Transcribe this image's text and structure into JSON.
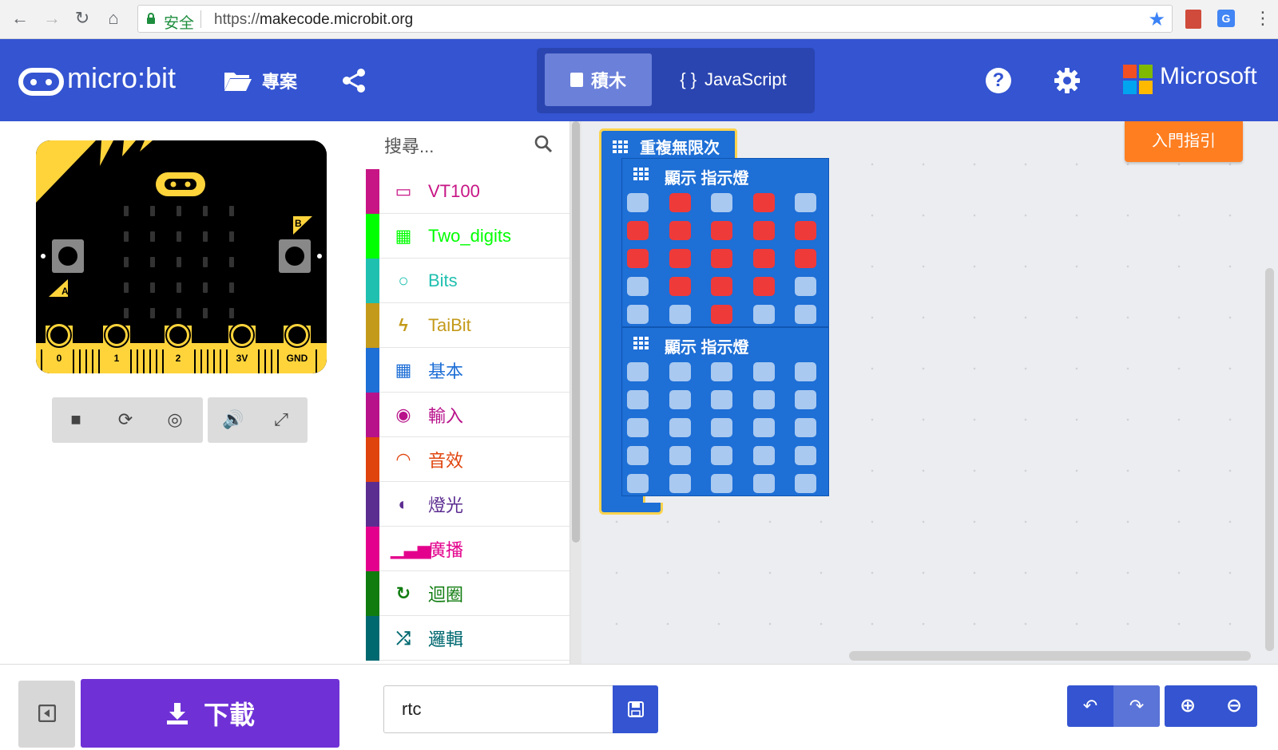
{
  "browser": {
    "secure_label": "安全",
    "url_scheme": "https://",
    "url_host": "makecode.microbit.org"
  },
  "header": {
    "logo_text": "micro:bit",
    "projects_label": "專案",
    "tab_blocks": "積木",
    "tab_js_brace": "{ }",
    "tab_js": "JavaScript",
    "brand": "Microsoft",
    "help_glyph": "?"
  },
  "simulator": {
    "pins": [
      "0",
      "1",
      "2",
      "3V",
      "GND"
    ],
    "button_a": "A",
    "button_b": "B"
  },
  "toolbox": {
    "search_placeholder": "搜尋...",
    "categories": [
      {
        "label": "VT100",
        "color": "#c71585",
        "icon": "monitor-icon"
      },
      {
        "label": "Two_digits",
        "color": "#00ff00",
        "icon": "grid-icon"
      },
      {
        "label": "Bits",
        "color": "#20c0b0",
        "icon": "circle-icon"
      },
      {
        "label": "TaiBit",
        "color": "#c49a1a",
        "icon": "bolt-icon"
      },
      {
        "label": "基本",
        "color": "#1e6fd6",
        "icon": "grid-dots-icon"
      },
      {
        "label": "輸入",
        "color": "#b8128b",
        "icon": "target-icon"
      },
      {
        "label": "音效",
        "color": "#e0440e",
        "icon": "headphones-icon"
      },
      {
        "label": "燈光",
        "color": "#5c2d91",
        "icon": "toggle-icon"
      },
      {
        "label": "廣播",
        "color": "#e3008c",
        "icon": "signal-icon"
      },
      {
        "label": "迴圈",
        "color": "#107c10",
        "icon": "loop-icon"
      },
      {
        "label": "邏輯",
        "color": "#006970",
        "icon": "shuffle-icon"
      }
    ]
  },
  "workspace": {
    "forever_label": "重複無限次",
    "show_leds_label": "顯示  指示燈",
    "intro_button": "入門指引",
    "led_on_color": "#ef3a3a",
    "led_off_color": "#a9c9f0",
    "leds1": [
      [
        0,
        1,
        0,
        1,
        0
      ],
      [
        1,
        1,
        1,
        1,
        1
      ],
      [
        1,
        1,
        1,
        1,
        1
      ],
      [
        0,
        1,
        1,
        1,
        0
      ],
      [
        0,
        0,
        1,
        0,
        0
      ]
    ],
    "leds2": [
      [
        0,
        0,
        0,
        0,
        0
      ],
      [
        0,
        0,
        0,
        0,
        0
      ],
      [
        0,
        0,
        0,
        0,
        0
      ],
      [
        0,
        0,
        0,
        0,
        0
      ],
      [
        0,
        0,
        0,
        0,
        0
      ]
    ]
  },
  "bottom": {
    "download_label": "下載",
    "project_name": "rtc"
  },
  "colors": {
    "header_blue": "#3454d1",
    "download_purple": "#6f31d6",
    "intro_orange": "#ff7e20",
    "micro_bit_yellow": "#ffd43b"
  }
}
